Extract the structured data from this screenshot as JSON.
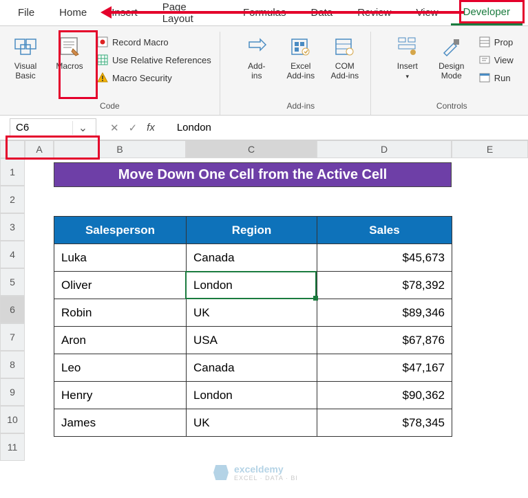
{
  "tabs": [
    "File",
    "Home",
    "Insert",
    "Page Layout",
    "Formulas",
    "Data",
    "Review",
    "View",
    "Developer"
  ],
  "active_tab": "Developer",
  "ribbon": {
    "code": {
      "visual_basic": "Visual\nBasic",
      "macros": "Macros",
      "record_macro": "Record Macro",
      "use_relative": "Use Relative References",
      "macro_security": "Macro Security",
      "group_label": "Code"
    },
    "addins": {
      "addins": "Add-\nins",
      "excel_addins": "Excel\nAdd-ins",
      "com_addins": "COM\nAdd-ins",
      "group_label": "Add-ins"
    },
    "controls": {
      "insert": "Insert",
      "design_mode": "Design\nMode",
      "properties": "Properties",
      "view_code": "View Code",
      "run_dialog": "Run Dialog",
      "group_label": "Controls"
    }
  },
  "name_box": "C6",
  "formula_value": "London",
  "columns": [
    "A",
    "B",
    "C",
    "D",
    "E"
  ],
  "row_numbers": [
    1,
    2,
    3,
    4,
    5,
    6,
    7,
    8,
    9,
    10,
    11
  ],
  "title": "Move Down One Cell from the Active Cell",
  "table": {
    "headers": [
      "Salesperson",
      "Region",
      "Sales"
    ],
    "rows": [
      [
        "Luka",
        "Canada",
        "$45,673"
      ],
      [
        "Oliver",
        "London",
        "$78,392"
      ],
      [
        "Robin",
        "UK",
        "$89,346"
      ],
      [
        "Aron",
        "USA",
        "$67,876"
      ],
      [
        "Leo",
        "Canada",
        "$47,167"
      ],
      [
        "Henry",
        "London",
        "$90,362"
      ],
      [
        "James",
        "UK",
        "$78,345"
      ]
    ]
  },
  "watermark": {
    "brand": "exceldemy",
    "tagline": "EXCEL · DATA · BI"
  }
}
